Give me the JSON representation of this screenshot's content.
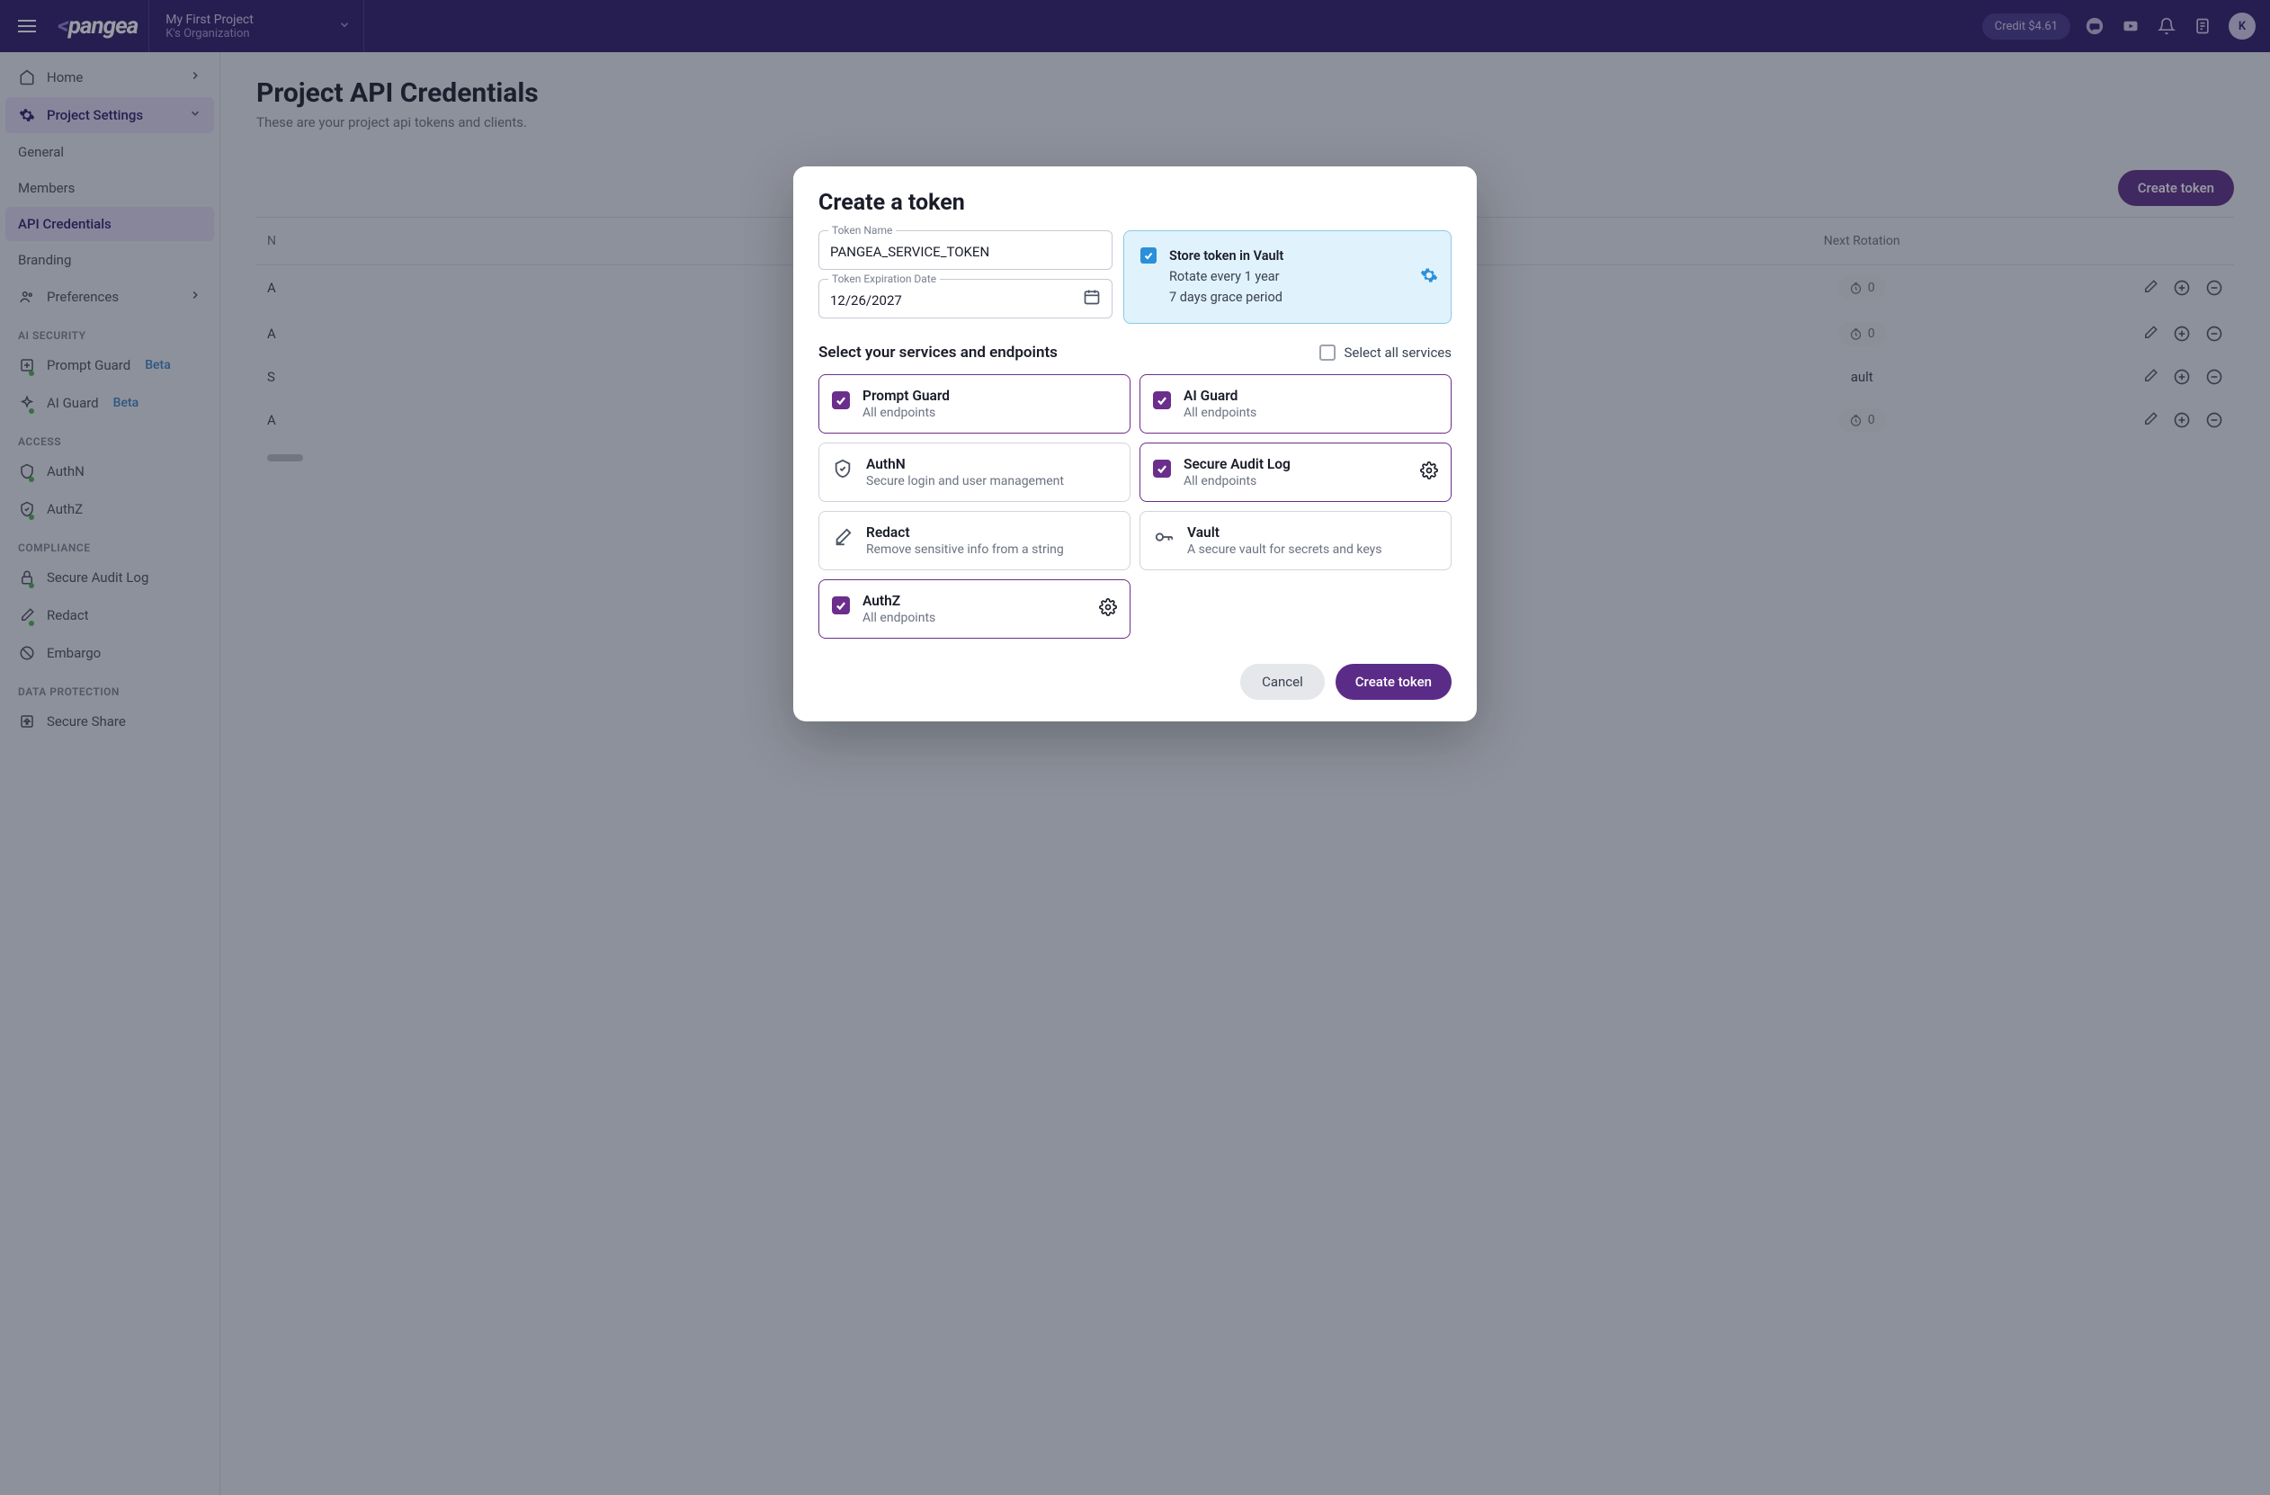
{
  "topbar": {
    "project_name": "My First Project",
    "org_name": "K's Organization",
    "credit": "Credit $4.61",
    "avatar_letter": "K",
    "logo": "pangea"
  },
  "sidebar": {
    "home": "Home",
    "project_settings": "Project Settings",
    "subs": {
      "general": "General",
      "members": "Members",
      "api_credentials": "API Credentials",
      "branding": "Branding"
    },
    "preferences": "Preferences",
    "sections": {
      "ai_security": "AI SECURITY",
      "access": "ACCESS",
      "compliance": "COMPLIANCE",
      "data_protection": "DATA PROTECTION"
    },
    "items": {
      "prompt_guard": "Prompt Guard",
      "ai_guard": "AI Guard",
      "authn": "AuthN",
      "authz": "AuthZ",
      "secure_audit_log": "Secure Audit Log",
      "redact": "Redact",
      "embargo": "Embargo",
      "secure_share": "Secure Share"
    },
    "beta": "Beta"
  },
  "page": {
    "title": "Project API Credentials",
    "subtitle": "These are your project api tokens and clients.",
    "create_button": "Create token",
    "columns": {
      "name": "N",
      "rotation": "Next Rotation"
    },
    "rows": [
      {
        "initial": "A",
        "rotation": "0"
      },
      {
        "initial": "A",
        "rotation": "0"
      },
      {
        "initial": "S",
        "vault": "ault"
      },
      {
        "initial": "A",
        "rotation": "0"
      }
    ]
  },
  "modal": {
    "title": "Create a token",
    "token_name_label": "Token Name",
    "token_name_value": "PANGEA_SERVICE_TOKEN",
    "exp_label": "Token Expiration Date",
    "exp_value": "12/26/2027",
    "vault": {
      "line1": "Store token in Vault",
      "line2": "Rotate every 1 year",
      "line3": "7 days grace period"
    },
    "select_label": "Select your services and endpoints",
    "select_all": "Select all services",
    "services": [
      {
        "name": "Prompt Guard",
        "desc": "All endpoints",
        "checked": true,
        "gear": false,
        "icon": "check"
      },
      {
        "name": "AI Guard",
        "desc": "All endpoints",
        "checked": true,
        "gear": false,
        "icon": "check"
      },
      {
        "name": "AuthN",
        "desc": "Secure login and user management",
        "checked": false,
        "gear": false,
        "icon": "shield"
      },
      {
        "name": "Secure Audit Log",
        "desc": "All endpoints",
        "checked": true,
        "gear": true,
        "icon": "check"
      },
      {
        "name": "Redact",
        "desc": "Remove sensitive info from a string",
        "checked": false,
        "gear": false,
        "icon": "pen"
      },
      {
        "name": "Vault",
        "desc": "A secure vault for secrets and keys",
        "checked": false,
        "gear": false,
        "icon": "key"
      },
      {
        "name": "AuthZ",
        "desc": "All endpoints",
        "checked": true,
        "gear": true,
        "icon": "check"
      }
    ],
    "cancel": "Cancel",
    "create": "Create token"
  }
}
